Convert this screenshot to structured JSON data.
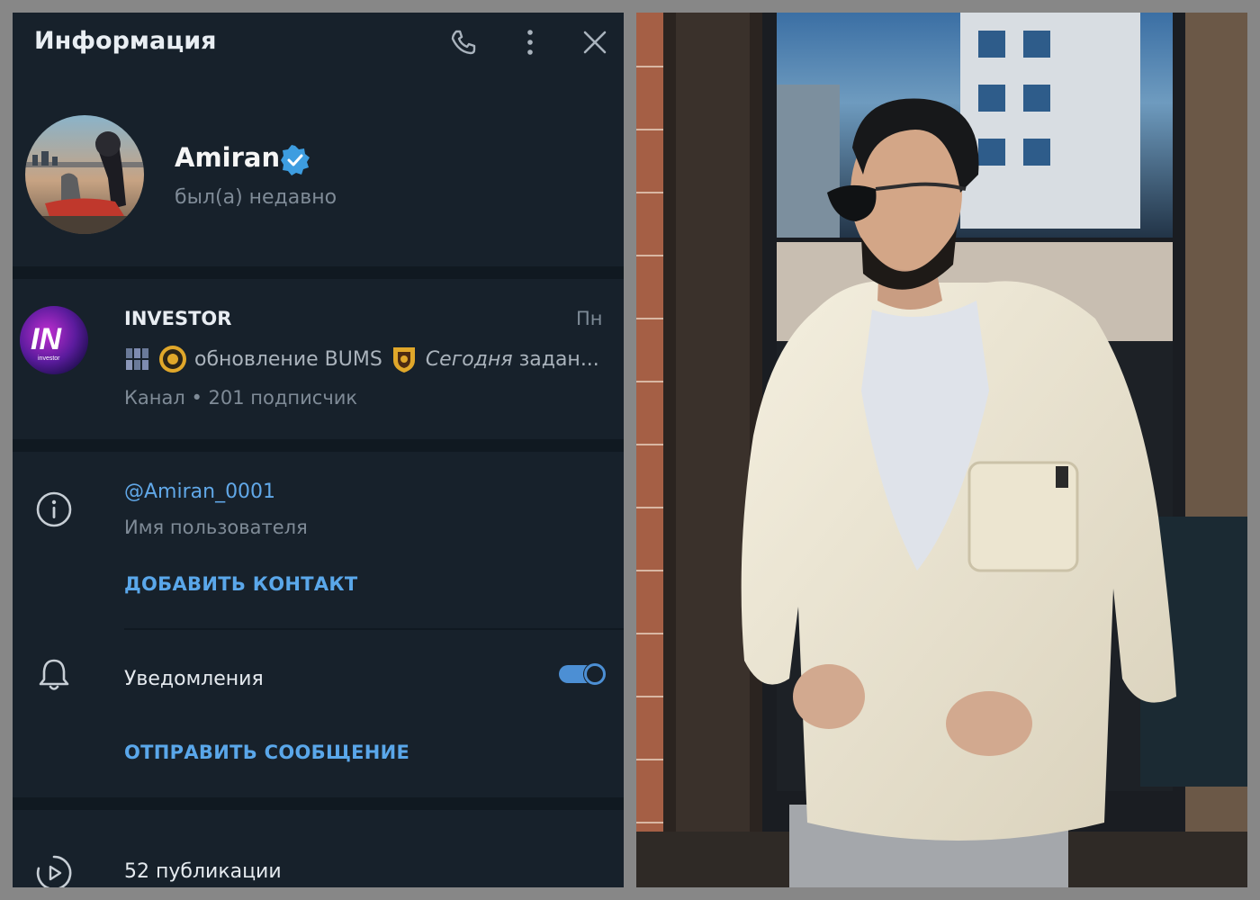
{
  "header": {
    "title": "Информация"
  },
  "profile": {
    "name": "Amiran",
    "status": "был(а) недавно"
  },
  "channel": {
    "name": "INVESTOR",
    "logo_text": "IN",
    "logo_subtext": "investor",
    "day": "Пн",
    "preview": {
      "part1": "обновление",
      "part2": "BUMS",
      "part3": "Сегодня",
      "part4": "задан..."
    },
    "meta": "Канал • 201 подписчик"
  },
  "info": {
    "username": "@Amiran_0001",
    "username_label": "Имя пользователя",
    "add_contact": "ДОБАВИТЬ КОНТАКТ",
    "notifications_label": "Уведомления",
    "notifications_on": true,
    "send_message": "ОТПРАВИТЬ СООБЩЕНИЕ"
  },
  "posts": {
    "label": "52 публикации"
  },
  "colors": {
    "panel_bg": "#17212b",
    "separator": "#101921",
    "accent": "#5aa7ea",
    "verified": "#3d9de0",
    "secondary_text": "#7f8b97"
  }
}
